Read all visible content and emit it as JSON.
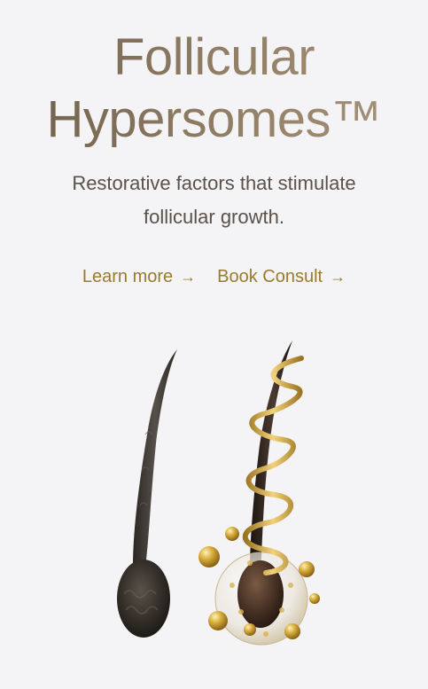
{
  "hero": {
    "title_line1": "Follicular",
    "title_line2": "Hypersomes™",
    "subtitle": "Restorative factors that stimulate follicular growth.",
    "links": [
      {
        "label": "Learn more",
        "arrow": "→"
      },
      {
        "label": "Book Consult",
        "arrow": "→"
      }
    ]
  },
  "colors": {
    "background": "#f4f3f6",
    "title_gradient_start": "#6e5e4a",
    "title_gradient_end": "#a8957a",
    "link": "#9a7a2e",
    "hair_dark": "#2e2a24",
    "gold": "#c9a033"
  },
  "illustration": {
    "left": "hair-follicle-icon",
    "right": "hair-follicle-with-gold-helix-icon"
  }
}
